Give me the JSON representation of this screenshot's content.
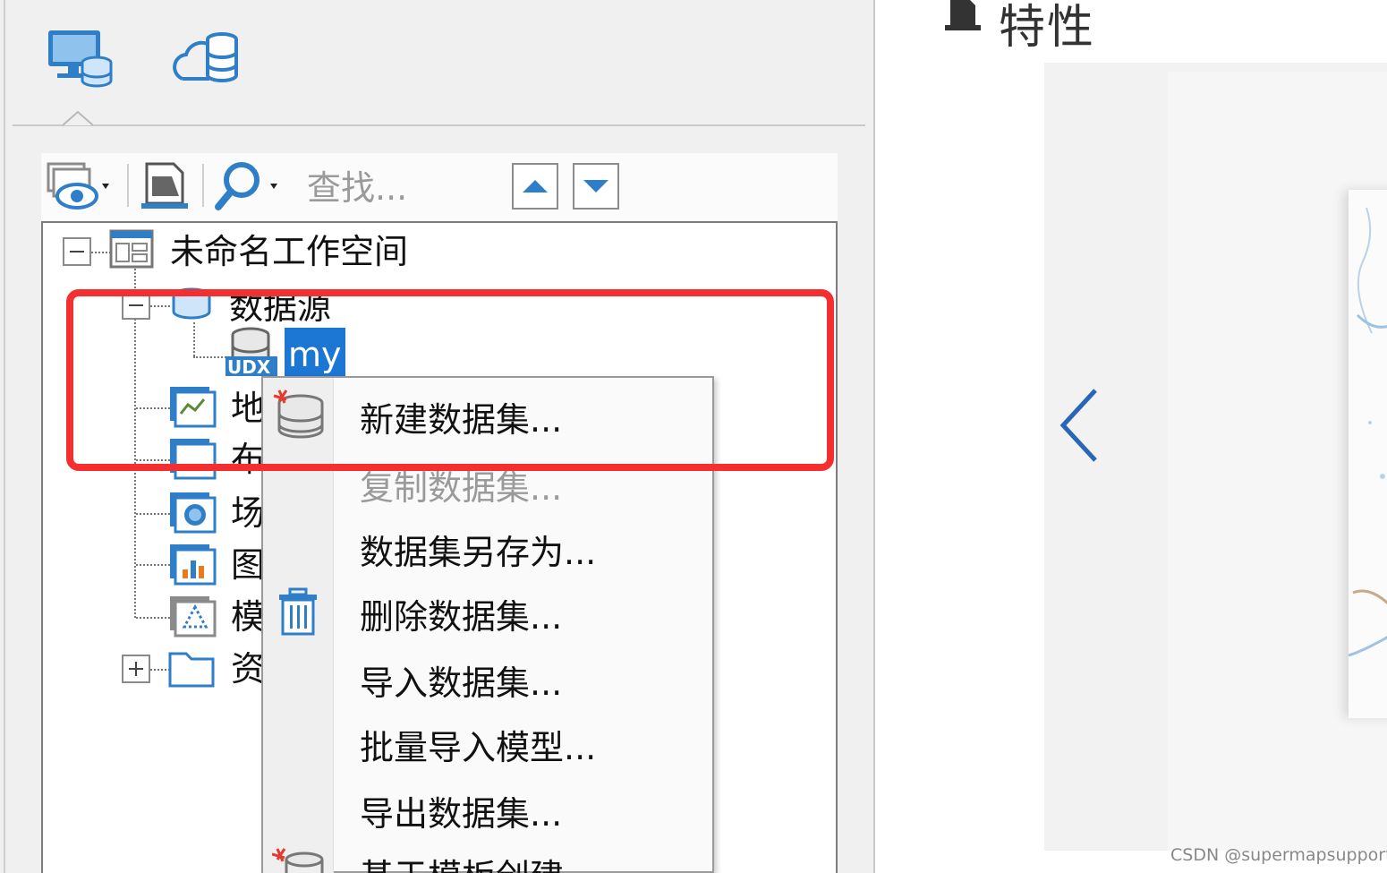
{
  "workspace_panel": {
    "tabs": [
      {
        "name": "local-datasource-tab",
        "icon": "computer-database-icon"
      },
      {
        "name": "cloud-datasource-tab",
        "icon": "cloud-database-icon"
      }
    ],
    "toolbar": {
      "search_placeholder": "查找..."
    },
    "tree": {
      "workspace": "未命名工作空间",
      "datasources": "数据源",
      "datasource_my": "my",
      "datasource_my_badge": "UDX",
      "maps": "地",
      "layouts": "布",
      "scenes": "场",
      "charts": "图",
      "models": "模",
      "resources": "资"
    }
  },
  "context_menu": {
    "items": [
      {
        "label": "新建数据集...",
        "enabled": true
      },
      {
        "label": "复制数据集...",
        "enabled": false
      },
      {
        "label": "数据集另存为...",
        "enabled": true
      },
      {
        "label": "删除数据集...",
        "enabled": true
      },
      {
        "label": "导入数据集...",
        "enabled": true
      },
      {
        "label": "批量导入模型...",
        "enabled": true
      },
      {
        "label": "导出数据集...",
        "enabled": true
      },
      {
        "label": "基于模板创建",
        "enabled": true
      }
    ]
  },
  "properties_panel": {
    "title": "特性"
  },
  "watermark": "CSDN @supermapsupport",
  "colors": {
    "highlight_border": "#f52f2f",
    "selection": "#1b76d4",
    "icon_blue": "#2f7fc8"
  }
}
